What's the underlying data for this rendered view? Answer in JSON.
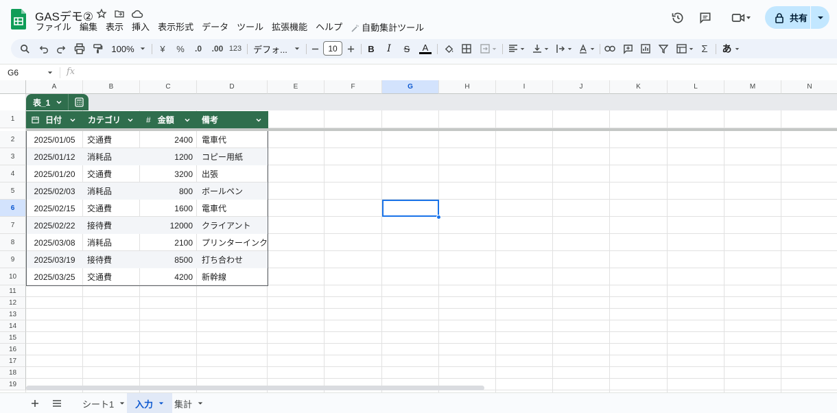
{
  "doc": {
    "title": "GASデモ②"
  },
  "menu": [
    "ファイル",
    "編集",
    "表示",
    "挿入",
    "表示形式",
    "データ",
    "ツール",
    "拡張機能",
    "ヘルプ"
  ],
  "custom_menu": "自動集計ツール",
  "share_label": "共有",
  "toolbar": {
    "zoom": "100%",
    "currency": "¥",
    "percent": "%",
    "dec_decrease": ".0",
    "dec_increase": ".00",
    "number_format": "123",
    "font": "デフォ...",
    "font_size": "10",
    "bold": "B",
    "italic": "I",
    "strike": "S",
    "text_color_label": "A",
    "input_tools": "あ"
  },
  "formula_bar": {
    "cell_ref": "G6",
    "fx": "fx",
    "value": ""
  },
  "columns": [
    "A",
    "B",
    "C",
    "D",
    "E",
    "F",
    "G",
    "H",
    "I",
    "J",
    "K",
    "L",
    "M",
    "N"
  ],
  "selected_column": "G",
  "rows": [
    "1",
    "2",
    "3",
    "4",
    "5",
    "6",
    "7",
    "8",
    "9",
    "10",
    "11",
    "12",
    "13",
    "14",
    "15",
    "16",
    "17",
    "18",
    "19"
  ],
  "selected_row": "6",
  "table": {
    "name": "表_1",
    "headers": [
      "日付",
      "カテゴリ",
      "金額",
      "備考"
    ],
    "rows": [
      [
        "2025/01/05",
        "交通費",
        "2400",
        "電車代"
      ],
      [
        "2025/01/12",
        "消耗品",
        "1200",
        "コピー用紙"
      ],
      [
        "2025/01/20",
        "交通費",
        "3200",
        "出張"
      ],
      [
        "2025/02/03",
        "消耗品",
        "800",
        "ボールペン"
      ],
      [
        "2025/02/15",
        "交通費",
        "1600",
        "電車代"
      ],
      [
        "2025/02/22",
        "接待費",
        "12000",
        "クライアント"
      ],
      [
        "2025/03/08",
        "消耗品",
        "2100",
        "プリンターインク"
      ],
      [
        "2025/03/19",
        "接待費",
        "8500",
        "打ち合わせ"
      ],
      [
        "2025/03/25",
        "交通費",
        "4200",
        "新幹線"
      ]
    ]
  },
  "sheets": [
    {
      "name": "シート1",
      "active": false
    },
    {
      "name": "入力",
      "active": true
    },
    {
      "name": "集計",
      "active": false
    }
  ],
  "colors": {
    "table_header": "#2f6e4d",
    "selection": "#1a73e8",
    "accent": "#0b57d0",
    "share_bg": "#c2e7ff"
  }
}
